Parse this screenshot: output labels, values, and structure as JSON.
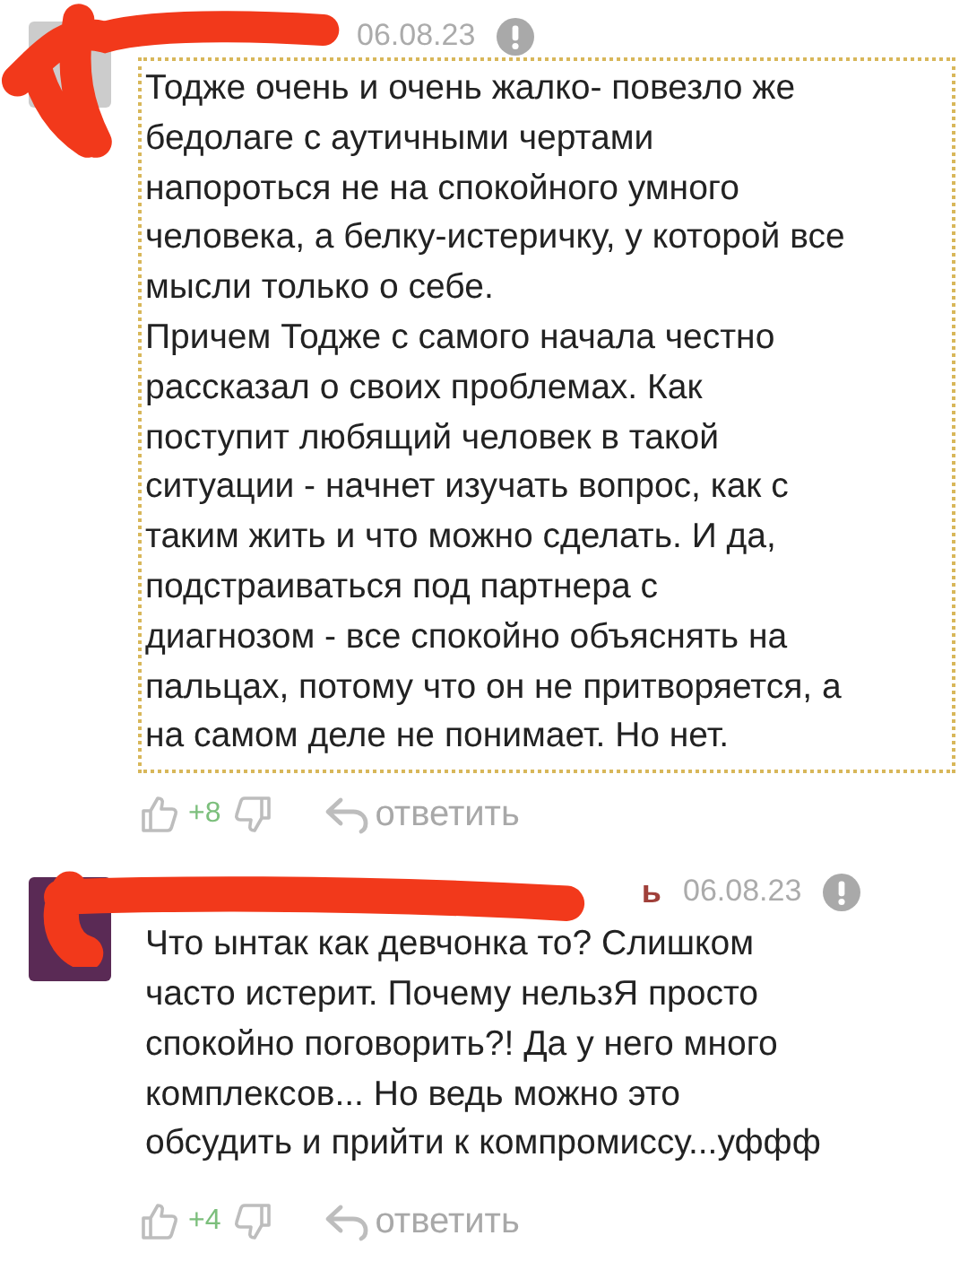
{
  "comments": [
    {
      "date": "06.08.23",
      "highlighted": true,
      "text": "Тодже очень и очень жалко- повезло же\nбедолаге с аутичными чертами\nнапороться не на спокойного умного\nчеловека, а белку-истеричку, у которой все\nмысли только о себе.\nПричем Тодже с самого начала честно\nрассказал о своих проблемах. Как\nпоступит любящий человек в такой\nситуации - начнет изучать вопрос, как с\nтаким жить и что можно сделать. И да,\nподстраиваться под партнера с\nдиагнозом - все спокойно объяснять на\nпальцах, потому что он не притворяется, а\nна самом деле не понимает. Но нет.",
      "rating": "+8",
      "reply": "ответить"
    },
    {
      "author_visible": "ь",
      "date": "06.08.23",
      "highlighted": false,
      "text": "Что ынтак как девчонка то? Слишком\nчасто истерит. Почему нельзЯ просто\nспокойно поговорить?! Да у него много\nкомплексов... Но ведь можно это\nобсудить и прийти к компромиссу...уффф",
      "rating": "+4",
      "reply": "ответить"
    }
  ]
}
